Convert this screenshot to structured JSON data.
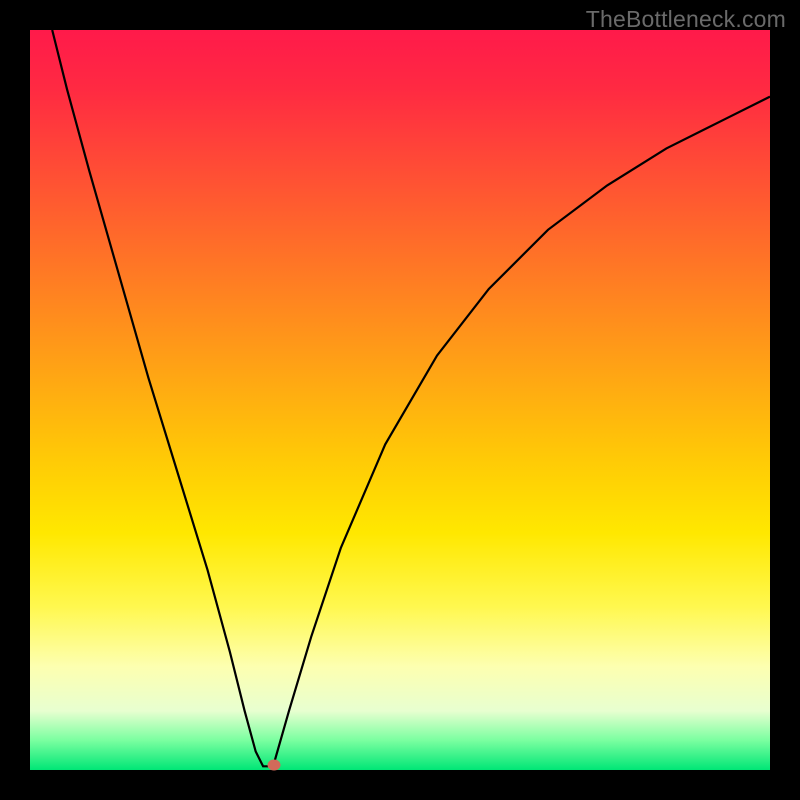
{
  "watermark": "TheBottleneck.com",
  "chart_data": {
    "type": "line",
    "title": "",
    "xlabel": "",
    "ylabel": "",
    "xlim": [
      0,
      100
    ],
    "ylim": [
      0,
      100
    ],
    "background_gradient": {
      "top": "#ff1a4a",
      "middle": "#ffe800",
      "bottom": "#00e676"
    },
    "series": [
      {
        "name": "bottleneck-curve",
        "x": [
          3,
          5,
          8,
          12,
          16,
          20,
          24,
          27,
          29,
          30.5,
          31.5,
          32.5,
          33,
          35,
          38,
          42,
          48,
          55,
          62,
          70,
          78,
          86,
          94,
          100
        ],
        "values": [
          100,
          92,
          81,
          67,
          53,
          40,
          27,
          16,
          8,
          2.5,
          0.5,
          0.5,
          1,
          8,
          18,
          30,
          44,
          56,
          65,
          73,
          79,
          84,
          88,
          91
        ],
        "color": "#000000",
        "stroke_width": 2
      }
    ],
    "annotations": [
      {
        "name": "minimum-marker",
        "type": "point",
        "x": 33,
        "y": 0.7,
        "color": "#d16a5a"
      }
    ]
  }
}
